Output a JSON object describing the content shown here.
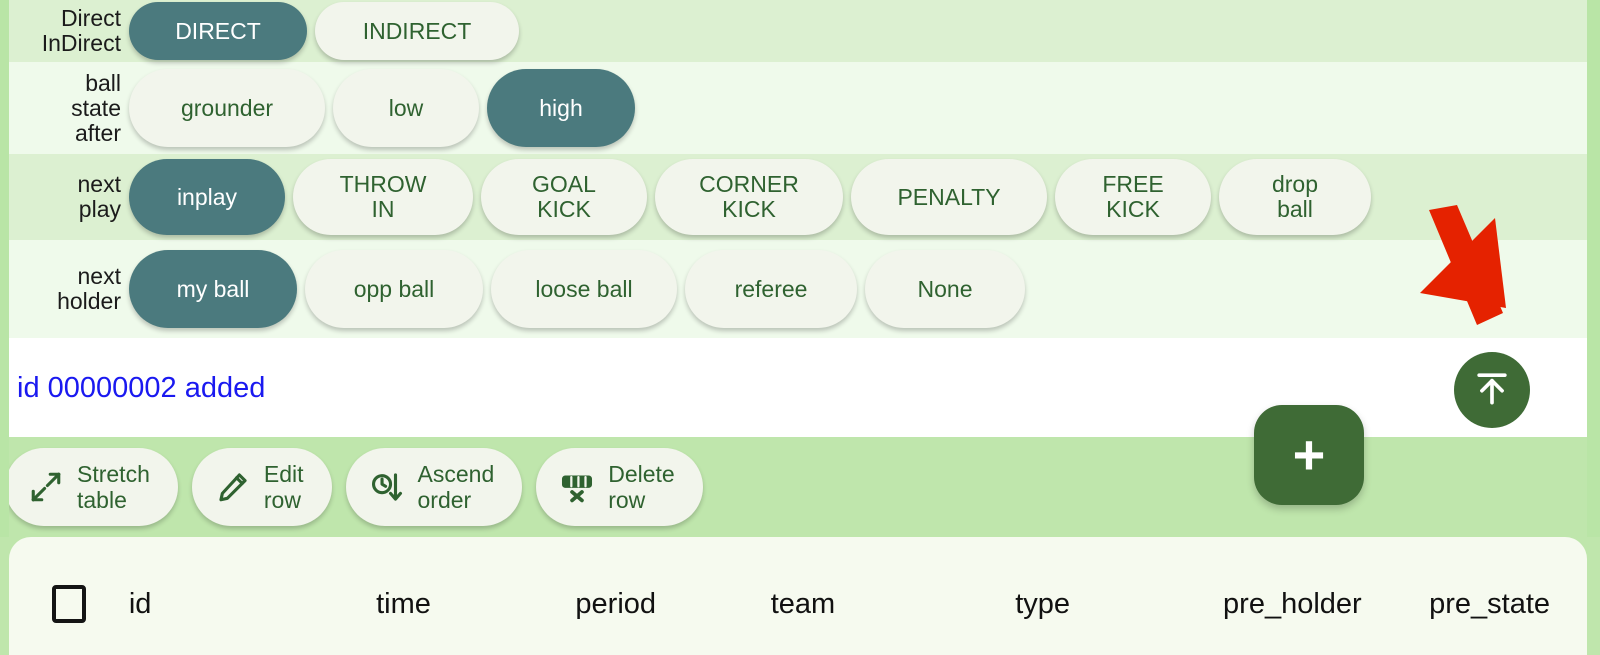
{
  "colors": {
    "selected_pill_bg": "#4b7a7e",
    "unselected_pill_bg": "#f2f5ec",
    "pill_text": "#2f6230",
    "row_dark": "#dcf0d1",
    "row_light": "#effaeb",
    "toolbar_bg": "#bfe6ac",
    "edge_strip": "#b9e5a6",
    "fab_green": "#3f6b36",
    "status_text": "#1a19f0",
    "annotation_arrow": "#e52200"
  },
  "option_rows": [
    {
      "label": "Direct\nInDirect",
      "name": "direct-indirect",
      "options": [
        {
          "label": "DIRECT",
          "selected": true
        },
        {
          "label": "INDIRECT",
          "selected": false
        }
      ]
    },
    {
      "label": "ball\nstate\nafter",
      "name": "ball-state-after",
      "options": [
        {
          "label": "grounder",
          "selected": false
        },
        {
          "label": "low",
          "selected": false
        },
        {
          "label": "high",
          "selected": true
        }
      ]
    },
    {
      "label": "next\nplay",
      "name": "next-play",
      "options": [
        {
          "label": "inplay",
          "selected": true
        },
        {
          "label": "THROW\nIN",
          "selected": false
        },
        {
          "label": "GOAL\nKICK",
          "selected": false
        },
        {
          "label": "CORNER\nKICK",
          "selected": false
        },
        {
          "label": "PENALTY",
          "selected": false
        },
        {
          "label": "FREE\nKICK",
          "selected": false
        },
        {
          "label": "drop\nball",
          "selected": false
        }
      ]
    },
    {
      "label": "next\nholder",
      "name": "next-holder",
      "options": [
        {
          "label": "my ball",
          "selected": true
        },
        {
          "label": "opp ball",
          "selected": false
        },
        {
          "label": "loose ball",
          "selected": false
        },
        {
          "label": "referee",
          "selected": false
        },
        {
          "label": "None",
          "selected": false
        }
      ]
    }
  ],
  "status": {
    "message": "id 00000002 added"
  },
  "toolbar": {
    "buttons": [
      {
        "label": "Stretch\ntable",
        "icon": "resize-diagonal-icon",
        "name": "stretch-table-button"
      },
      {
        "label": "Edit\nrow",
        "icon": "pencil-icon",
        "name": "edit-row-button"
      },
      {
        "label": "Ascend\norder",
        "icon": "clock-arrow-down-icon",
        "name": "ascend-order-button"
      },
      {
        "label": "Delete\nrow",
        "icon": "row-delete-icon",
        "name": "delete-row-button"
      }
    ]
  },
  "fabs": {
    "scroll_top": {
      "icon": "arrow-to-top-icon",
      "name": "scroll-to-top-fab"
    },
    "add": {
      "label": "+",
      "icon": "plus-icon",
      "name": "add-record-fab"
    }
  },
  "annotation": {
    "arrow": "red-pointer-arrow"
  },
  "table": {
    "select_all_checked": false,
    "columns": [
      "id",
      "time",
      "period",
      "team",
      "type",
      "pre_holder",
      "pre_state"
    ]
  }
}
